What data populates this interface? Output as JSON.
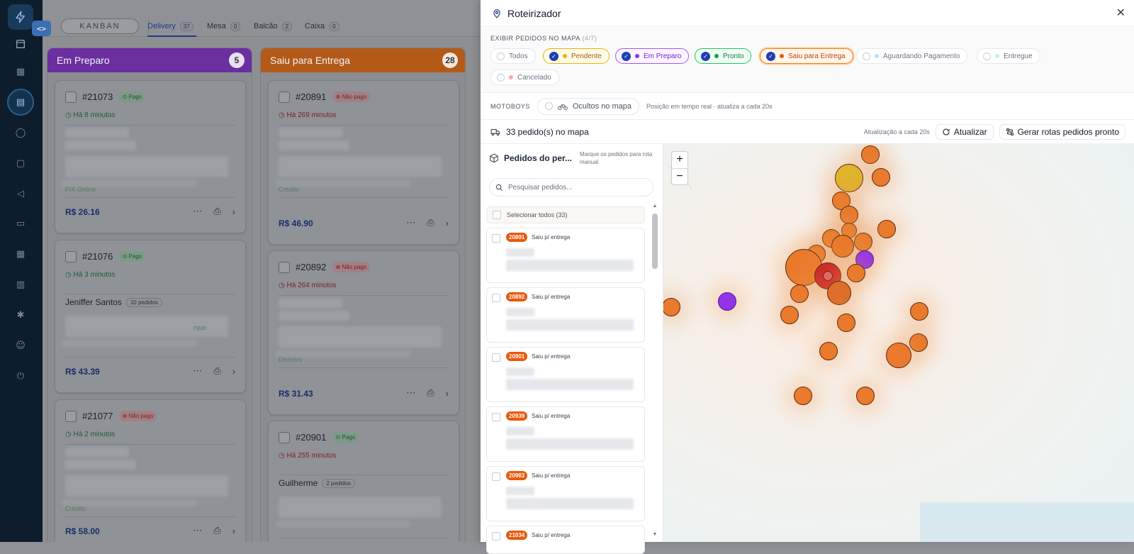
{
  "sidebar": {
    "items": [
      {
        "name": "dashboard-icon",
        "glyph": "▦"
      },
      {
        "name": "orders-icon",
        "glyph": "▤"
      },
      {
        "name": "chat-icon",
        "glyph": "◯"
      },
      {
        "name": "bag-icon",
        "glyph": "▢"
      },
      {
        "name": "megaphone-icon",
        "glyph": "◁"
      },
      {
        "name": "folder-icon",
        "glyph": "▭"
      },
      {
        "name": "grid-icon",
        "glyph": "▦"
      },
      {
        "name": "chart-icon",
        "glyph": "▥"
      },
      {
        "name": "gear-icon",
        "glyph": "✱"
      },
      {
        "name": "user-icon",
        "glyph": "☺"
      },
      {
        "name": "power-icon",
        "glyph": "⏻"
      }
    ]
  },
  "board": {
    "mode_label": "KANBAN",
    "tabs": [
      {
        "label": "Delivery",
        "count": "37"
      },
      {
        "label": "Mesa",
        "count": "0"
      },
      {
        "label": "Balcão",
        "count": "2"
      },
      {
        "label": "Caixa",
        "count": "0"
      }
    ],
    "columns": [
      {
        "title": "Em Preparo",
        "count": "5",
        "color": "#6b2fa0",
        "cards": [
          {
            "number": "#21073",
            "payment": "Pago",
            "paid": true,
            "time": "Há 8 minutos",
            "customer": "",
            "orders": "",
            "price": "R$ 26.16",
            "note": "PIX Online"
          },
          {
            "number": "#21076",
            "payment": "Pago",
            "paid": true,
            "time": "Há 3 minutos",
            "customer": "Jeniffer Santos",
            "orders": "10 pedidos",
            "price": "R$ 43.39",
            "note": "rque"
          },
          {
            "number": "#21077",
            "payment": "Não pago",
            "paid": false,
            "time": "Há 2 minutos",
            "customer": "",
            "orders": "",
            "price": "R$ 58.00",
            "note": "Crédito"
          }
        ]
      },
      {
        "title": "Saiu para Entrega",
        "count": "28",
        "color": "#b35a19",
        "cards": [
          {
            "number": "#20891",
            "payment": "Não pago",
            "paid": false,
            "time": "Há 269 minutos",
            "customer": "",
            "orders": "",
            "price": "R$ 46.90",
            "note": "Crédito"
          },
          {
            "number": "#20892",
            "payment": "Não pago",
            "paid": false,
            "time": "Há 264 minutos",
            "customer": "",
            "orders": "",
            "price": "R$ 31.43",
            "note": "Dinheiro"
          },
          {
            "number": "#20901",
            "payment": "Pago",
            "paid": true,
            "time": "Há 255 minutos",
            "customer": "Guilherme",
            "orders": "2 pedidos",
            "price": "",
            "note": ""
          }
        ]
      }
    ]
  },
  "panel": {
    "title": "Roteirizador",
    "filters_label": "EXIBIR PEDIDOS NO MAPA",
    "filters_count": "(4/7)",
    "filters": [
      {
        "label": "Todos",
        "checked": false,
        "dot": "",
        "border": "#e5e7eb",
        "bg": "#fff",
        "text": "#6b7280"
      },
      {
        "label": "Pendente",
        "checked": true,
        "dot": "#eab308",
        "border": "#eab308",
        "bg": "#fffbea",
        "text": "#a16207"
      },
      {
        "label": "Em Preparo",
        "checked": true,
        "dot": "#9333ea",
        "border": "#a855f7",
        "bg": "#faf5ff",
        "text": "#7e22ce"
      },
      {
        "label": "Pronto",
        "checked": true,
        "dot": "#16a34a",
        "border": "#22c55e",
        "bg": "#f0fdf4",
        "text": "#15803d"
      },
      {
        "label": "Saiu para Entrega",
        "checked": true,
        "dot": "#ea580c",
        "border": "#f97316",
        "bg": "#fff7ed",
        "text": "#c2410c"
      },
      {
        "label": "Aguardando Pagamento",
        "checked": false,
        "dot": "#bfdbfe",
        "border": "#e5e7eb",
        "bg": "#fff",
        "text": "#6b7280"
      },
      {
        "label": "Entregue",
        "checked": false,
        "dot": "#bbf7d0",
        "border": "#e5e7eb",
        "bg": "#fff",
        "text": "#6b7280"
      },
      {
        "label": "Cancelado",
        "checked": false,
        "dot": "#fca5a5",
        "border": "#e5e7eb",
        "bg": "#fff",
        "text": "#6b7280"
      }
    ],
    "moto_label": "MOTOBOYS",
    "moto_chip": "Ocultos no mapa",
    "moto_note": "Posição em tempo real · atualiza a cada 20s",
    "map_count": "33 pedido(s) no mapa",
    "update_note": "Atualização a cada 20s",
    "refresh_label": "Atualizar",
    "routes_label": "Gerar rotas pedidos pronto",
    "list_title": "Pedidos do per...",
    "list_hint": "Marque os pedidos para rota manual",
    "search_placeholder": "Pesquisar pedidos...",
    "select_all": "Selecionar todos (33)",
    "orders": [
      {
        "num": "20891",
        "status": "Saiu p/ entrega"
      },
      {
        "num": "20892",
        "status": "Saiu p/ entrega"
      },
      {
        "num": "20901",
        "status": "Saiu p/ entrega"
      },
      {
        "num": "20939",
        "status": "Saiu p/ entrega"
      },
      {
        "num": "20983",
        "status": "Saiu p/ entrega"
      },
      {
        "num": "21034",
        "status": "Saiu p/ entrega"
      }
    ]
  },
  "map": {
    "zoom_in": "+",
    "zoom_out": "−"
  }
}
